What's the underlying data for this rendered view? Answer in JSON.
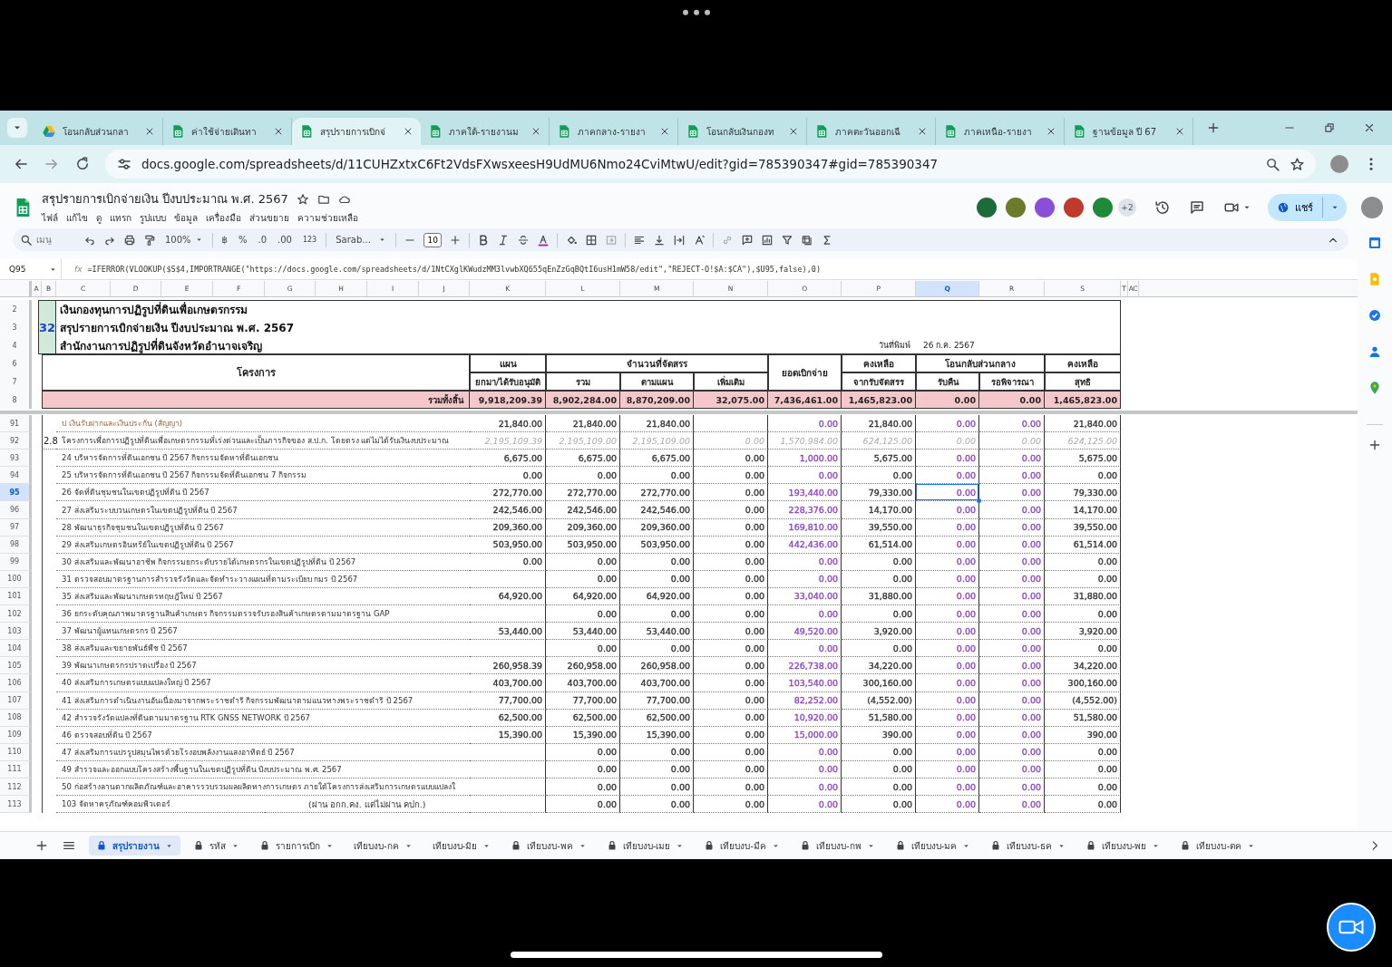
{
  "browser": {
    "tabs": [
      {
        "title": "โอนกลับส่วนกลา",
        "selected": false
      },
      {
        "title": "ค่าใช้จ่ายเดินทา",
        "selected": false
      },
      {
        "title": "สรุปรายการเบิกจ่",
        "selected": true
      },
      {
        "title": "ภาคใต้-รายงานม",
        "selected": false
      },
      {
        "title": "ภาคกลาง-รายงา",
        "selected": false
      },
      {
        "title": "โอนกลับเงินกองท",
        "selected": false
      },
      {
        "title": "ภาคตะวันออกเฉี",
        "selected": false
      },
      {
        "title": "ภาคเหนือ-รายงา",
        "selected": false
      },
      {
        "title": "ฐานข้อมูล ปี 67",
        "selected": false
      }
    ],
    "url": "docs.google.com/spreadsheets/d/11CUHZxtxC6Ft2VdsFXwsxeesH9UdMU6Nmo24CviMtwU/edit?gid=785390347#gid=785390347"
  },
  "doc": {
    "title": "สรุปรายการเบิกจ่ายเงิน ปีงบประมาณ พ.ศ. 2567",
    "menus": [
      "ไฟล์",
      "แก้ไข",
      "ดู",
      "แทรก",
      "รูปแบบ",
      "ข้อมูล",
      "เครื่องมือ",
      "ส่วนขยาย",
      "ความช่วยเหลือ"
    ],
    "collaborators": [
      {
        "color": "#1e6b3a"
      },
      {
        "color": "#6b7b2a"
      },
      {
        "color": "#8a4fd8"
      },
      {
        "color": "#c0392b"
      },
      {
        "color": "#1f8a3a"
      }
    ],
    "more_collaborators": "+2",
    "share_label": "แชร์"
  },
  "toolbar": {
    "search_placeholder": "เมนู",
    "zoom": "100%",
    "currency": "฿",
    "percent": "%",
    "decrease_decimal": ".0",
    "increase_decimal": ".00",
    "number_format": "123",
    "font": "Sarab...",
    "font_size": "10"
  },
  "formula_bar": {
    "cell": "Q95",
    "fx": "fx",
    "formula": "=IFERROR(VLOOKUP($S$4,IMPORTRANGE(\"https://docs.google.com/spreadsheets/d/1NtCXglKWudzMM3lvwbXQ655qEnZzGqBQtI6usH1mW58/edit\",\"REJECT-O!$A:$CA\"),$U95,false),0)"
  },
  "sheet": {
    "columns": [
      {
        "letter": "A",
        "selected": false
      },
      {
        "letter": "B",
        "selected": false
      },
      {
        "letter": "C",
        "selected": false
      },
      {
        "letter": "D",
        "selected": false
      },
      {
        "letter": "E",
        "selected": false
      },
      {
        "letter": "F",
        "selected": false
      },
      {
        "letter": "G",
        "selected": false
      },
      {
        "letter": "H",
        "selected": false
      },
      {
        "letter": "I",
        "selected": false
      },
      {
        "letter": "J",
        "selected": false
      },
      {
        "letter": "K",
        "selected": false,
        "color": "#333333"
      },
      {
        "letter": "L",
        "selected": false,
        "color": "#333333"
      },
      {
        "letter": "M",
        "selected": false,
        "color": "#333333"
      },
      {
        "letter": "N",
        "selected": false,
        "color": "#333333"
      },
      {
        "letter": "O",
        "selected": false,
        "color": "#8e44c4"
      },
      {
        "letter": "P",
        "selected": false,
        "color": "#333333"
      },
      {
        "letter": "Q",
        "selected": true,
        "color": "#8e44c4"
      },
      {
        "letter": "R",
        "selected": false,
        "color": "#8e44c4"
      },
      {
        "letter": "S",
        "selected": false,
        "color": "#333333"
      },
      {
        "letter": "T",
        "selected": false
      },
      {
        "letter": "AC",
        "selected": false
      }
    ],
    "header_row_numbers": [
      "2",
      "3",
      "4",
      "6",
      "7",
      "8"
    ],
    "badge": "32",
    "title_lines": [
      "เงินกองทุนการปฏิรูปที่ดินเพื่อเกษตรกรรม",
      "สรุปรายการเบิกจ่ายเงิน ปีงบประมาณ พ.ศ. 2567",
      "สำนักงานการปฏิรูปที่ดินจังหวัดอำนาจเจริญ"
    ],
    "print_date_label": "วันที่พิมพ์",
    "print_date": "26 ก.ค. 2567",
    "project_label": "โครงการ",
    "heading_top": [
      "แผน",
      "จำนวนที่จัดสรร",
      "ยอดเบิกจ่าย",
      "คงเหลือ",
      "โอนกลับส่วนกลาง",
      "คงเหลือ"
    ],
    "heading_sub": [
      "ยกมา/ได้รับอนุมัติ",
      "รวม",
      "ตามแผน",
      "เพิ่มเติม",
      "จากรับจัดสรร",
      "รับคืน",
      "รอพิจารณา",
      "สุทธิ"
    ],
    "total_row": {
      "label": "รวมทั้งสิ้น",
      "values": [
        "9,918,209.39",
        "8,902,284.00",
        "8,870,209.00",
        "32,075.00",
        "7,436,461.00",
        "1,465,823.00",
        "0.00",
        "0.00",
        "1,465,823.00"
      ]
    },
    "rows": [
      {
        "num": "91",
        "kind": "deposit",
        "selected": false,
        "name": "ป เงินรับฝากและเงินประกัน (สัญญา)",
        "values": {
          "K": "21,840.00",
          "L": "21,840.00",
          "M": "21,840.00",
          "O": "0.00",
          "P": "21,840.00",
          "Q": "0.00",
          "R": "0.00",
          "S": "21,840.00"
        }
      },
      {
        "num": "92",
        "kind": "group",
        "selected": false,
        "code": "2.8",
        "name": "โครงการเพื่อการปฏิรูปที่ดินเพื่อเกษตรกรรมที่เร่งด่วนและเป็นภารกิจของ ส.ป.ก. โดยตรง แต่ไม่ได้รับเงินงบประมาณ",
        "values": {
          "K": "2,195,109.39",
          "L": "2,195,109.00",
          "M": "2,195,109.00",
          "N": "0.00",
          "O": "1,570,984.00",
          "P": "624,125.00",
          "Q": "0.00",
          "R": "0.00",
          "S": "624,125.00"
        }
      },
      {
        "num": "93",
        "kind": "item",
        "selected": false,
        "name": "24 บริหารจัดการที่ดินเอกชน ปี 2567  กิจกรรมจัดหาที่ดินเอกชน",
        "values": {
          "K": "6,675.00",
          "L": "6,675.00",
          "M": "6,675.00",
          "N": "0.00",
          "O": "1,000.00",
          "P": "5,675.00",
          "Q": "0.00",
          "R": "0.00",
          "S": "5,675.00"
        }
      },
      {
        "num": "94",
        "kind": "item",
        "selected": false,
        "name": "25 บริหารจัดการที่ดินเอกชน ปี 2567  กิจกรรมจัดที่ดินเอกชน 7 กิจกรรม",
        "values": {
          "K": "0.00",
          "L": "0.00",
          "M": "0.00",
          "N": "0.00",
          "O": "0.00",
          "P": "0.00",
          "Q": "0.00",
          "R": "0.00",
          "S": "0.00"
        }
      },
      {
        "num": "95",
        "kind": "item",
        "selected": true,
        "name": "26 จัดที่ดินชุมชนในเขตปฏิรูปที่ดิน ปี  2567",
        "values": {
          "K": "272,770.00",
          "L": "272,770.00",
          "M": "272,770.00",
          "N": "0.00",
          "O": "193,440.00",
          "P": "79,330.00",
          "Q": "0.00",
          "R": "0.00",
          "S": "79,330.00"
        }
      },
      {
        "num": "96",
        "kind": "item",
        "selected": false,
        "name": "27 ส่งเสริมระบบวนเกษตรในเขตปฏิรูปที่ดิน ปี  2567",
        "values": {
          "K": "242,546.00",
          "L": "242,546.00",
          "M": "242,546.00",
          "N": "0.00",
          "O": "228,376.00",
          "P": "14,170.00",
          "Q": "0.00",
          "R": "0.00",
          "S": "14,170.00"
        }
      },
      {
        "num": "97",
        "kind": "item",
        "selected": false,
        "name": "28 พัฒนาธุรกิจชุมชนในเขตปฏิรูปที่ดิน ปี  2567",
        "values": {
          "K": "209,360.00",
          "L": "209,360.00",
          "M": "209,360.00",
          "N": "0.00",
          "O": "169,810.00",
          "P": "39,550.00",
          "Q": "0.00",
          "R": "0.00",
          "S": "39,550.00"
        }
      },
      {
        "num": "98",
        "kind": "item",
        "selected": false,
        "name": "29 ส่งเสริมเกษตรอินทรีย์ในเขตปฏิรูปที่ดิน ปี  2567",
        "values": {
          "K": "503,950.00",
          "L": "503,950.00",
          "M": "503,950.00",
          "N": "0.00",
          "O": "442,436.00",
          "P": "61,514.00",
          "Q": "0.00",
          "R": "0.00",
          "S": "61,514.00"
        }
      },
      {
        "num": "99",
        "kind": "item",
        "selected": false,
        "name": "30 ส่งเสริมและพัฒนาอาชีพ กิจกรรมยกระดับรายได้เกษตรกรในเขตปฏิรูปที่ดิน ปี  2567",
        "values": {
          "K": "0.00",
          "L": "0.00",
          "M": "0.00",
          "N": "0.00",
          "O": "0.00",
          "P": "0.00",
          "Q": "0.00",
          "R": "0.00",
          "S": "0.00"
        }
      },
      {
        "num": "100",
        "kind": "item",
        "selected": false,
        "name": "31 ตรวจสอบมาตรฐานการสำรวจรังวัดและจัดทำระวางแผนที่ตามระเบียบ กมร ปี 2567",
        "values": {
          "L": "0.00",
          "M": "0.00",
          "N": "0.00",
          "O": "0.00",
          "P": "0.00",
          "Q": "0.00",
          "R": "0.00",
          "S": "0.00"
        }
      },
      {
        "num": "101",
        "kind": "item",
        "selected": false,
        "name": "35 ส่งเสริมและพัฒนาเกษตรทฤษฎีใหม่ ปี 2567",
        "values": {
          "K": "64,920.00",
          "L": "64,920.00",
          "M": "64,920.00",
          "N": "0.00",
          "O": "33,040.00",
          "P": "31,880.00",
          "Q": "0.00",
          "R": "0.00",
          "S": "31,880.00"
        }
      },
      {
        "num": "102",
        "kind": "item",
        "selected": false,
        "name": "36 ยกระดับคุณภาพมาตรฐานสินค้าเกษตร กิจกรรมตรวจรับรองสินค้าเกษตรตามมาตรฐาน GAP",
        "values": {
          "L": "0.00",
          "M": "0.00",
          "N": "0.00",
          "O": "0.00",
          "P": "0.00",
          "Q": "0.00",
          "R": "0.00",
          "S": "0.00"
        }
      },
      {
        "num": "103",
        "kind": "item",
        "selected": false,
        "name": "37 พัฒนาผู้แทนเกษตรกร ปี 2567",
        "values": {
          "K": "53,440.00",
          "L": "53,440.00",
          "M": "53,440.00",
          "N": "0.00",
          "O": "49,520.00",
          "P": "3,920.00",
          "Q": "0.00",
          "R": "0.00",
          "S": "3,920.00"
        }
      },
      {
        "num": "104",
        "kind": "item",
        "selected": false,
        "name": "38 ส่งเสริมและขยายพันธ์พืช ปี 2567",
        "values": {
          "L": "0.00",
          "M": "0.00",
          "N": "0.00",
          "O": "0.00",
          "P": "0.00",
          "Q": "0.00",
          "R": "0.00",
          "S": "0.00"
        }
      },
      {
        "num": "105",
        "kind": "item",
        "selected": false,
        "name": "39 พัฒนาเกษตรกรปราดเปรื่อง ปี 2567",
        "values": {
          "K": "260,958.39",
          "L": "260,958.00",
          "M": "260,958.00",
          "N": "0.00",
          "O": "226,738.00",
          "P": "34,220.00",
          "Q": "0.00",
          "R": "0.00",
          "S": "34,220.00"
        }
      },
      {
        "num": "106",
        "kind": "item",
        "selected": false,
        "name": "40 ส่งเสริมการเกษตรแบบแปลงใหญ่ ปี 2567",
        "values": {
          "K": "403,700.00",
          "L": "403,700.00",
          "M": "403,700.00",
          "N": "0.00",
          "O": "103,540.00",
          "P": "300,160.00",
          "Q": "0.00",
          "R": "0.00",
          "S": "300,160.00"
        }
      },
      {
        "num": "107",
        "kind": "item",
        "selected": false,
        "name": "41 ส่งเสริมการดำเนินงานอันเนื่องมาจากพระราชดำริ กิจกรรมพัฒนาตามแนวทางพระราชดำริ ปี 2567",
        "values": {
          "K": "77,700.00",
          "L": "77,700.00",
          "M": "77,700.00",
          "N": "0.00",
          "O": "82,252.00",
          "P": "(4,552.00)",
          "Q": "0.00",
          "R": "0.00",
          "S": "(4,552.00)"
        }
      },
      {
        "num": "108",
        "kind": "item",
        "selected": false,
        "name": "42 สำรวจรังวัดแปลงที่ดินตามมาตรฐาน RTK GNSS NETWORK  ปี 2567",
        "values": {
          "K": "62,500.00",
          "L": "62,500.00",
          "M": "62,500.00",
          "N": "0.00",
          "O": "10,920.00",
          "P": "51,580.00",
          "Q": "0.00",
          "R": "0.00",
          "S": "51,580.00"
        }
      },
      {
        "num": "109",
        "kind": "item",
        "selected": false,
        "name": "46 ตรวจสอบที่ดิน ปี 2567",
        "values": {
          "K": "15,390.00",
          "L": "15,390.00",
          "M": "15,390.00",
          "N": "0.00",
          "O": "15,000.00",
          "P": "390.00",
          "Q": "0.00",
          "R": "0.00",
          "S": "390.00"
        }
      },
      {
        "num": "110",
        "kind": "item",
        "selected": false,
        "name": "47 ส่งเสริมการแปรรูปสมุนไพรด้วยโรงอบพลังงานแสงอาทิตย์ ปี 2567",
        "values": {
          "L": "0.00",
          "M": "0.00",
          "N": "0.00",
          "O": "0.00",
          "P": "0.00",
          "Q": "0.00",
          "R": "0.00",
          "S": "0.00"
        }
      },
      {
        "num": "111",
        "kind": "item",
        "selected": false,
        "name": "49 สำรวจและออกแบบโครงสร้างพื้นฐานในเขตปฏิรูปที่ดิน ปีงบประมาณ พ.ศ. 2567",
        "values": {
          "L": "0.00",
          "M": "0.00",
          "N": "0.00",
          "O": "0.00",
          "P": "0.00",
          "Q": "0.00",
          "R": "0.00",
          "S": "0.00"
        }
      },
      {
        "num": "112",
        "kind": "item",
        "selected": false,
        "name": "50 ก่อสร้างลานตากผลิตภัณฑ์และอาคารรวบรวมผลผลิตทางการเกษตร ภายใต้โครงการส่งเสริมการเกษตรแบบแปลงใ",
        "values": {
          "L": "0.00",
          "M": "0.00",
          "N": "0.00",
          "O": "0.00",
          "P": "0.00",
          "Q": "0.00",
          "R": "0.00",
          "S": "0.00"
        }
      },
      {
        "num": "113",
        "kind": "item",
        "selected": false,
        "name": "103 จัดหาครุภัณฑ์คอมพิวเตอร์",
        "note": "(ผ่าน อกก.คง. แต่ไม่ผ่าน คปก.)",
        "values": {
          "L": "0.00",
          "M": "0.00",
          "N": "0.00",
          "O": "0.00",
          "P": "0.00",
          "Q": "0.00",
          "R": "0.00",
          "S": "0.00"
        }
      }
    ]
  },
  "sheet_tabs": [
    {
      "label": "สรุปรายงาน",
      "locked": true,
      "selected": true
    },
    {
      "label": "รหัส",
      "locked": true,
      "selected": false
    },
    {
      "label": "รายการเบิก",
      "locked": true,
      "selected": false
    },
    {
      "label": "เทียบงบ-กค",
      "locked": false,
      "selected": false
    },
    {
      "label": "เทียบงบ-มิย",
      "locked": false,
      "selected": false
    },
    {
      "label": "เทียบงบ-พค",
      "locked": true,
      "selected": false
    },
    {
      "label": "เทียบงบ-เมย",
      "locked": true,
      "selected": false
    },
    {
      "label": "เทียบงบ-มีค",
      "locked": true,
      "selected": false
    },
    {
      "label": "เทียบงบ-กพ",
      "locked": true,
      "selected": false
    },
    {
      "label": "เทียบงบ-มค",
      "locked": true,
      "selected": false
    },
    {
      "label": "เทียบงบ-ธค",
      "locked": true,
      "selected": false
    },
    {
      "label": "เทียบงบ-พย",
      "locked": true,
      "selected": false
    },
    {
      "label": "เทียบงบ-ตค",
      "locked": true,
      "selected": false
    }
  ]
}
